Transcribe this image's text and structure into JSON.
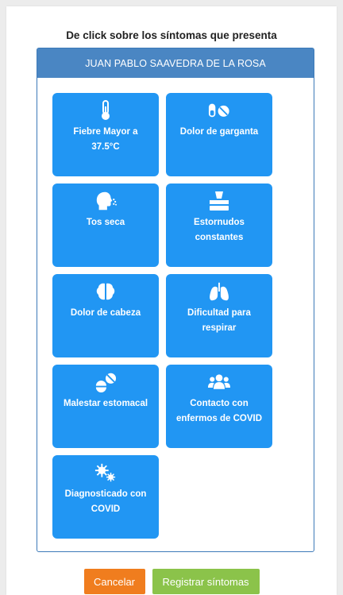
{
  "header": {
    "instruction": "De click sobre los síntomas que presenta"
  },
  "panel": {
    "patient_name": "JUAN PABLO SAAVEDRA DE LA ROSA"
  },
  "symptoms": [
    {
      "label": "Fiebre Mayor a 37.5°C",
      "icon": "thermometer-icon"
    },
    {
      "label": "Dolor de garganta",
      "icon": "pills-icon"
    },
    {
      "label": "Tos seca",
      "icon": "head-cough-icon"
    },
    {
      "label": "Estornudos constantes",
      "icon": "tissue-box-icon"
    },
    {
      "label": "Dolor de cabeza",
      "icon": "brain-icon"
    },
    {
      "label": "Dificultad para respirar",
      "icon": "lungs-icon"
    },
    {
      "label": "Malestar estomacal",
      "icon": "tablets-icon"
    },
    {
      "label": "Contacto con enfermos de COVID",
      "icon": "people-icon"
    },
    {
      "label": "Diagnosticado con COVID",
      "icon": "virus-icon"
    }
  ],
  "footer": {
    "cancel_label": "Cancelar",
    "submit_label": "Registrar síntomas"
  },
  "colors": {
    "tile": "#2196f3",
    "header": "#4a86c3",
    "cancel": "#f07d1e",
    "submit": "#8bc34a"
  }
}
